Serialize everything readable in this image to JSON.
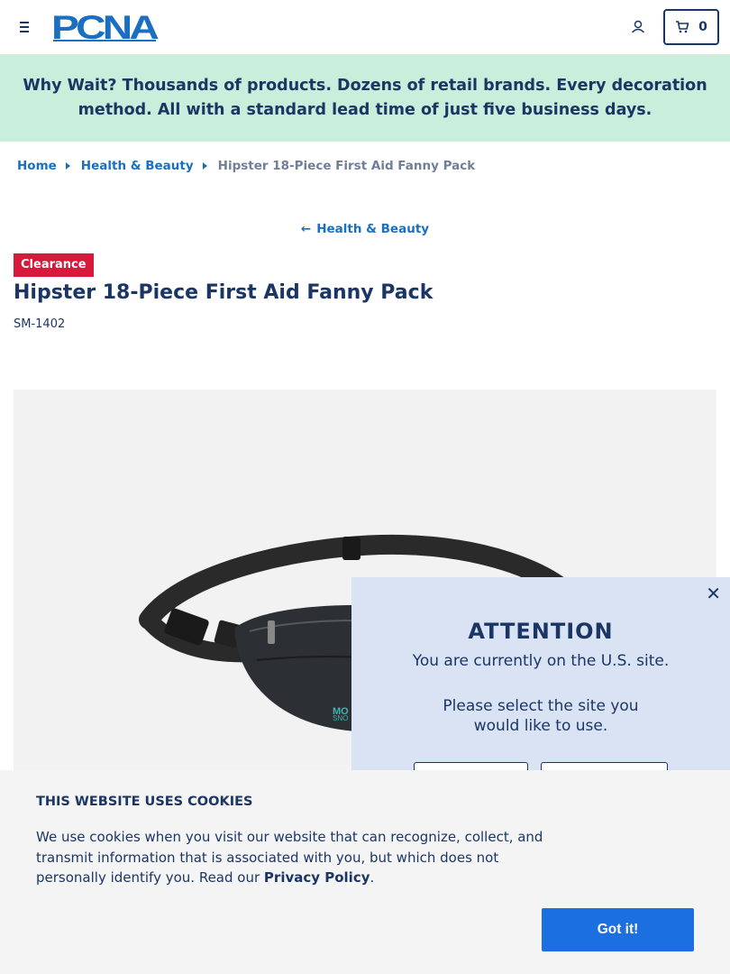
{
  "header": {
    "logo_text": "PCNA",
    "cart_count": "0"
  },
  "banner": {
    "text": "Why Wait? Thousands of products. Dozens of retail brands. Every decoration method. All with a standard lead time of just five business days."
  },
  "breadcrumb": {
    "items": [
      "Home",
      "Health & Beauty"
    ],
    "current": "Hipster 18-Piece First Aid Fanny Pack"
  },
  "back_link": {
    "arrow": "←",
    "label": "Health & Beauty"
  },
  "product": {
    "badge": "Clearance",
    "title": "Hipster 18-Piece First Aid Fanny Pack",
    "sku": "SM-1402",
    "image_print_text": [
      "MO",
      "SNO"
    ]
  },
  "attention_popup": {
    "close": "✕",
    "title": "ATTENTION",
    "message": "You are currently on the U.S. site.",
    "select_line1": "Please select the site you",
    "select_line2": "would like to use."
  },
  "cookie_banner": {
    "title": "THIS WEBSITE USES COOKIES",
    "text": "We use cookies when you visit our website that can recognize, collect, and transmit information that is associated with you, but which does not personally identify you. Read our",
    "link": "Privacy Policy",
    "period": ".",
    "button": "Got it!"
  },
  "colors": {
    "navy": "#1b3665",
    "link_blue": "#1b6fc0",
    "banner_green": "#c9eedb",
    "clearance_red": "#d71a3c",
    "popup_bg": "#d9e3f3",
    "button_blue": "#1b6fe0"
  },
  "icons": [
    "hamburger-menu-icon",
    "user-account-icon",
    "shopping-cart-icon",
    "close-icon",
    "back-arrow-icon",
    "breadcrumb-caret-icon"
  ]
}
